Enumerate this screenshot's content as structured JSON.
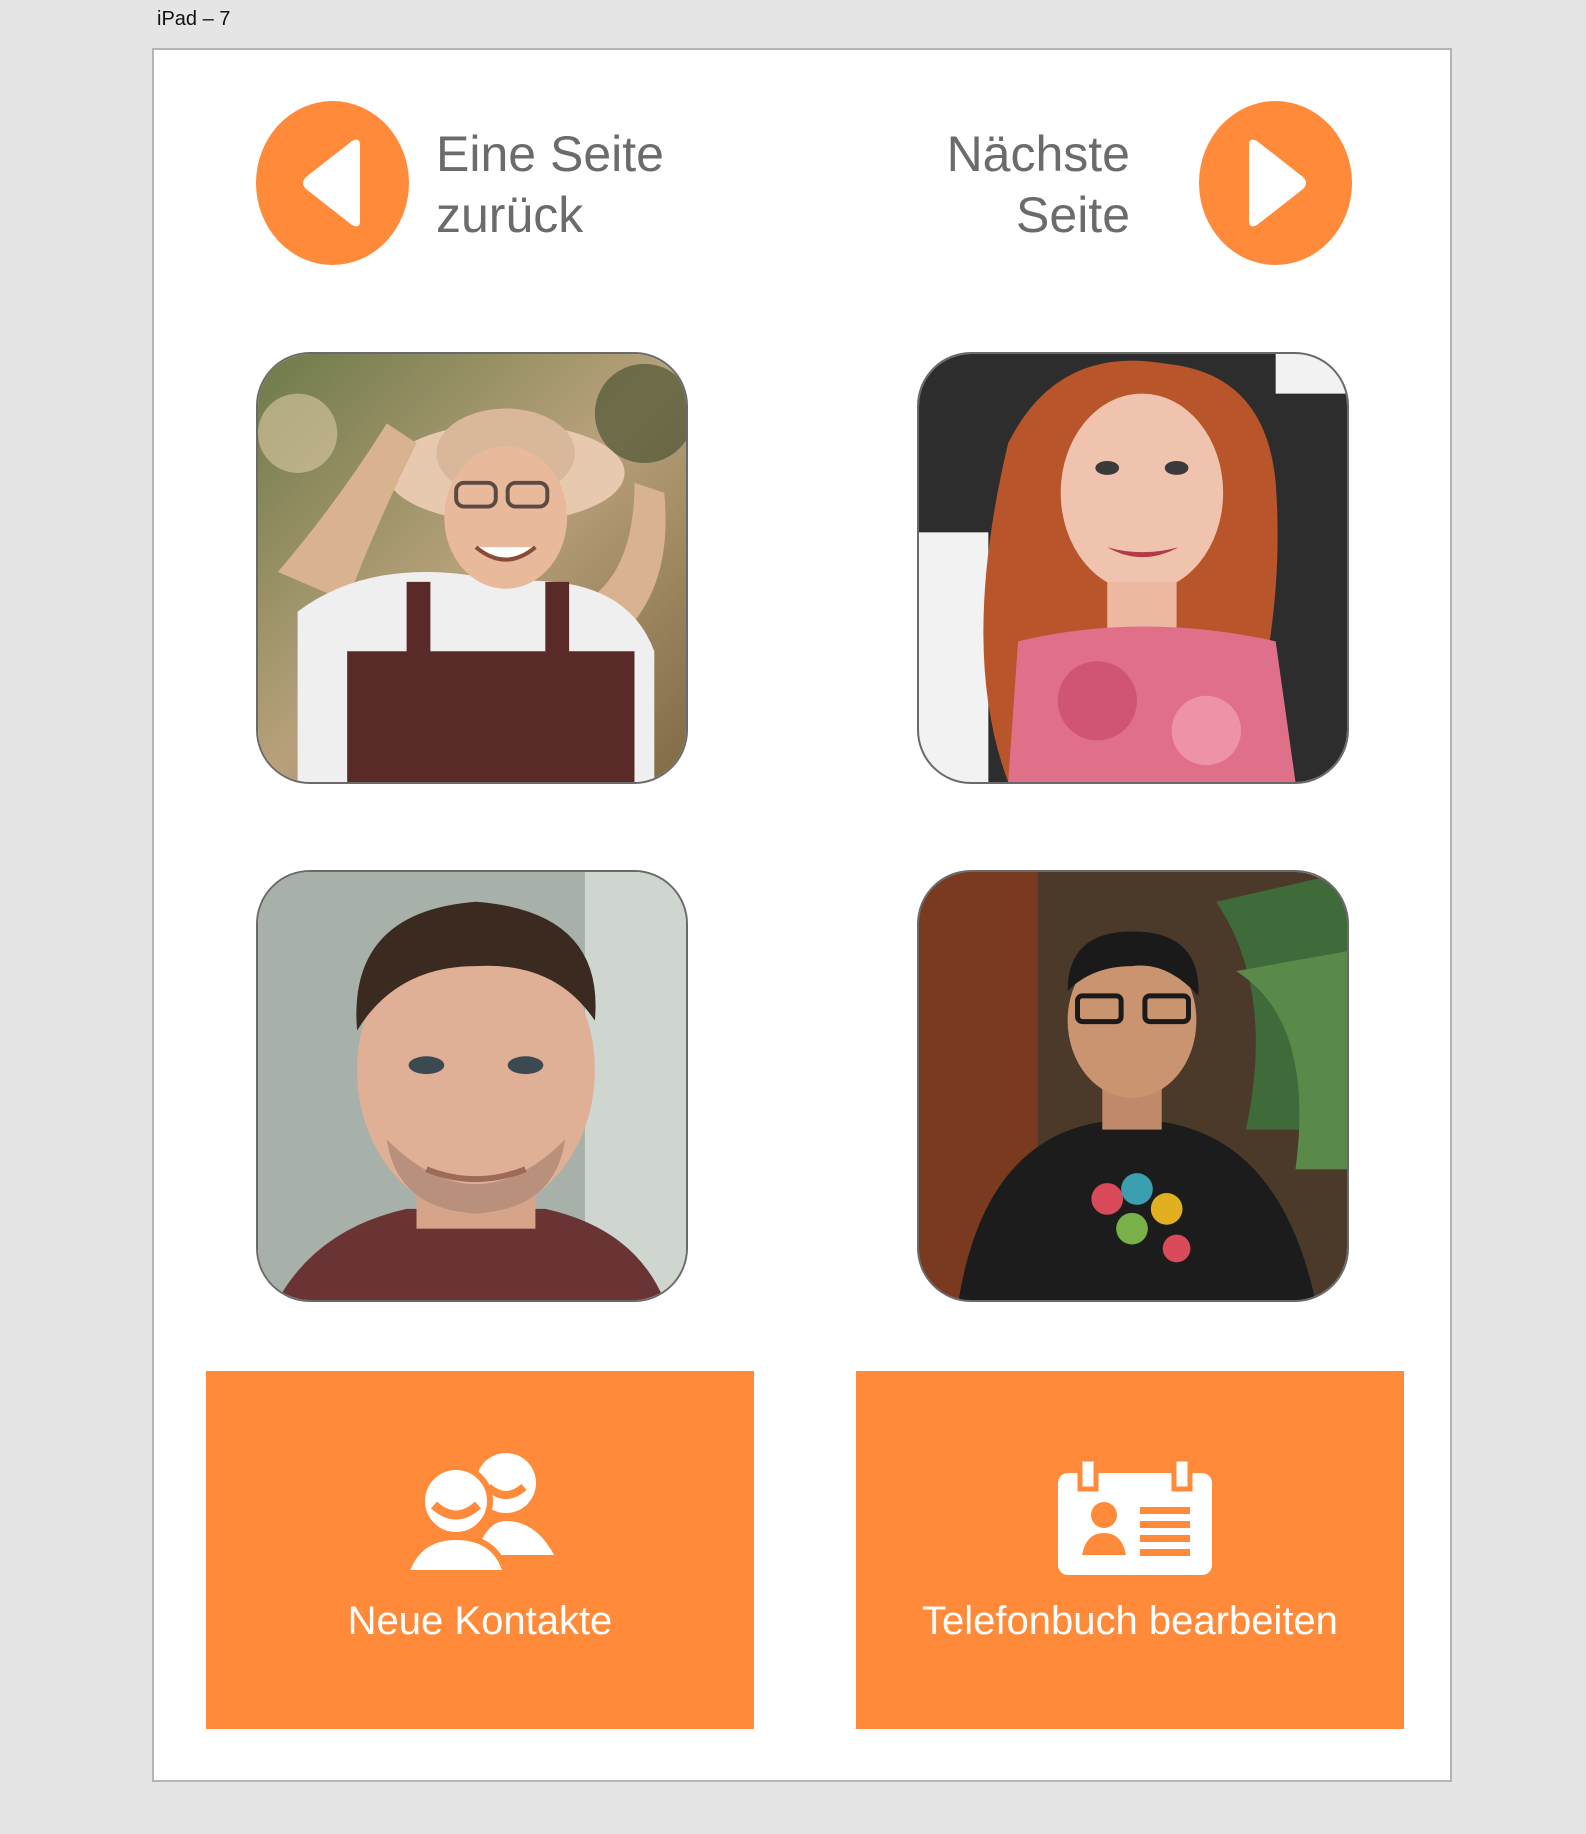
{
  "artboard": {
    "title": "iPad – 7"
  },
  "nav": {
    "back": {
      "line1": "Eine Seite",
      "line2": "zurück",
      "icon": "arrow-left-icon"
    },
    "next": {
      "line1": "Nächste",
      "line2": "Seite",
      "icon": "arrow-right-icon"
    }
  },
  "contacts": [
    {
      "photo": "elderly-woman-with-sun-hat"
    },
    {
      "photo": "red-haired-woman"
    },
    {
      "photo": "man-with-stubble"
    },
    {
      "photo": "young-man-with-glasses"
    }
  ],
  "actions": {
    "new_contacts": {
      "label": "Neue Kontakte",
      "icon": "people-icon"
    },
    "edit_phonebook": {
      "label": "Telefonbuch bearbeiten",
      "icon": "id-card-icon"
    }
  },
  "colors": {
    "accent": "#ff8a3a",
    "nav_text": "#6b6b6b",
    "canvas": "#e5e5e5",
    "artboard": "#ffffff"
  }
}
